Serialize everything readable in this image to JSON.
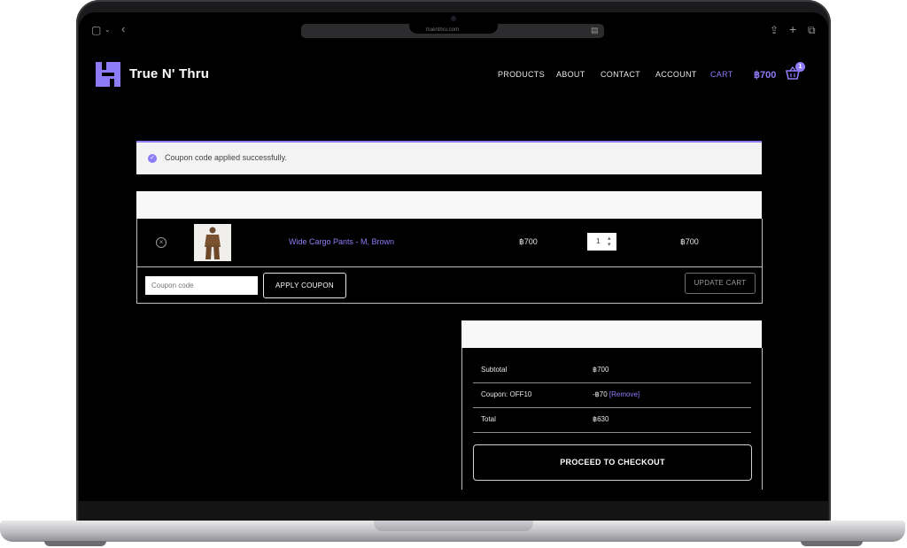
{
  "browser": {
    "url_text": "truenthru.com"
  },
  "header": {
    "brand": "True N' Thru",
    "nav": [
      "PRODUCTS",
      "ABOUT",
      "CONTACT",
      "ACCOUNT",
      "CART"
    ],
    "active_nav": "CART",
    "cart_total": "฿700",
    "cart_count": "1"
  },
  "notice": {
    "text": "Coupon code applied successfully."
  },
  "cart": {
    "item": {
      "name": "Wide Cargo Pants - M, Brown",
      "price": "฿700",
      "quantity": "1",
      "subtotal": "฿700"
    },
    "coupon_placeholder": "Coupon code",
    "apply_label": "APPLY COUPON",
    "update_label": "UPDATE CART"
  },
  "totals": {
    "subtotal_label": "Subtotal",
    "subtotal_value": "฿700",
    "coupon_label": "Coupon: OFF10",
    "coupon_value": "-฿70",
    "remove_label": "[Remove]",
    "total_label": "Total",
    "total_value": "฿630",
    "checkout_label": "PROCEED TO CHECKOUT"
  },
  "colors": {
    "accent": "#8d7bf7",
    "background": "#000000",
    "frame": "#1b1b1d"
  }
}
